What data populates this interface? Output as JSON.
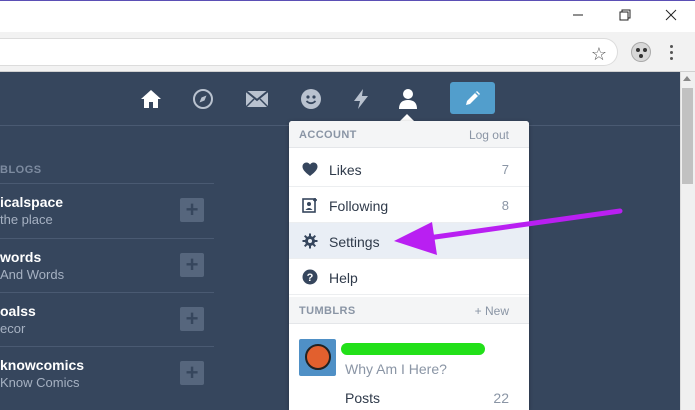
{
  "browser": {
    "window_buttons": [
      "minimize",
      "restore",
      "close"
    ],
    "bookmark_icon": "star-icon",
    "extension_icon": "soccer-ball-icon",
    "menu_icon": "kebab-menu-icon"
  },
  "navbar": {
    "icons": [
      "home-icon",
      "compass-icon",
      "mail-icon",
      "smiley-icon",
      "lightning-icon",
      "person-icon"
    ],
    "compose_icon": "pencil-icon",
    "compose_color": "#529ecc"
  },
  "sidebar": {
    "heading": "BLOGS",
    "blogs": [
      {
        "title": "icalspace",
        "subtitle": "the place"
      },
      {
        "title": "words",
        "subtitle": "And Words"
      },
      {
        "title": "oalss",
        "subtitle": "ecor"
      },
      {
        "title": "knowcomics",
        "subtitle": "Know Comics"
      }
    ]
  },
  "account_menu": {
    "header": "ACCOUNT",
    "logout_label": "Log out",
    "items": [
      {
        "label": "Likes",
        "count": "7",
        "icon": "heart-icon"
      },
      {
        "label": "Following",
        "count": "8",
        "icon": "following-icon"
      },
      {
        "label": "Settings",
        "count": "",
        "icon": "gear-icon"
      },
      {
        "label": "Help",
        "count": "",
        "icon": "help-icon"
      }
    ],
    "tumblrs_header": "TUMBLRS",
    "new_label": "+ New",
    "blog": {
      "title": "Why Am I Here?",
      "posts_label": "Posts",
      "posts_count": "22"
    }
  },
  "colors": {
    "dashboard_bg": "#36465d",
    "annotation_arrow": "#b91ff2",
    "redaction": "#22e019"
  }
}
